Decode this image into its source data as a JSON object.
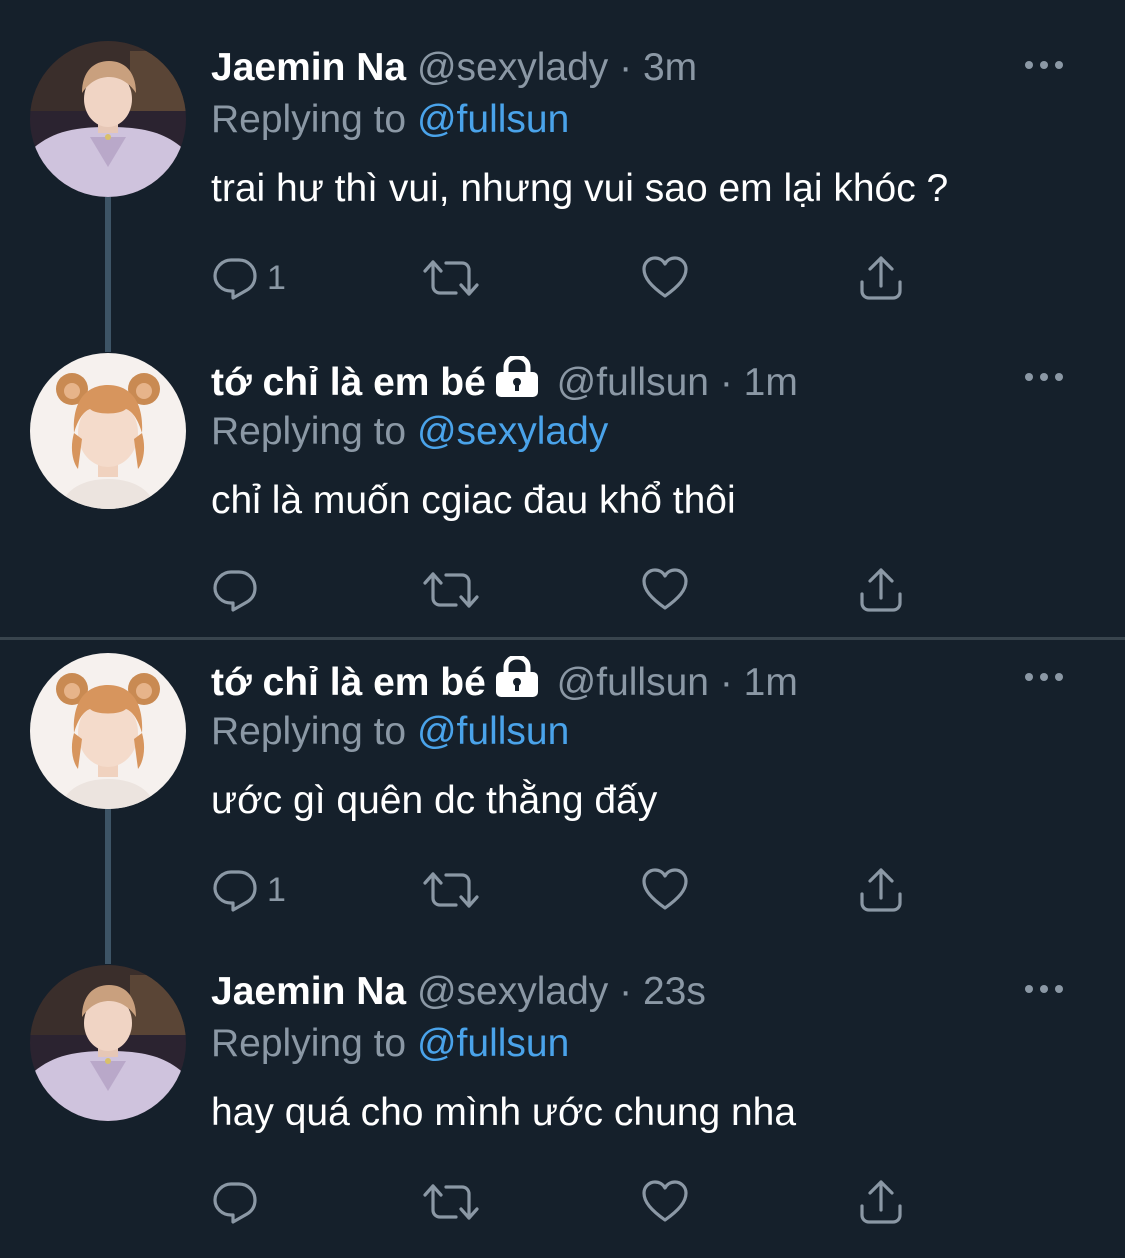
{
  "tweets": [
    {
      "name": "Jaemin Na",
      "locked": false,
      "handle": "@sexylady",
      "separator": "·",
      "time": "3m",
      "replying_prefix": "Replying to ",
      "replying_to": "@fullsun",
      "text": "trai hư thì vui, nhưng vui sao em lại khóc ?",
      "reply_count": "1",
      "avatar": "jaemin-avatar"
    },
    {
      "name": "tớ chỉ là em bé",
      "locked": true,
      "handle": "@fullsun",
      "separator": "·",
      "time": "1m",
      "replying_prefix": "Replying to ",
      "replying_to": "@sexylady",
      "text": "chỉ là muốn cgiac đau khổ thôi",
      "reply_count": "",
      "avatar": "fullsun-avatar"
    },
    {
      "name": "tớ chỉ là em bé",
      "locked": true,
      "handle": "@fullsun",
      "separator": "·",
      "time": "1m",
      "replying_prefix": "Replying to ",
      "replying_to": "@fullsun",
      "text": "ước gì quên dc thằng đấy",
      "reply_count": "1",
      "avatar": "fullsun-avatar"
    },
    {
      "name": "Jaemin Na",
      "locked": false,
      "handle": "@sexylady",
      "separator": "·",
      "time": "23s",
      "replying_prefix": "Replying to ",
      "replying_to": "@fullsun",
      "text": "hay quá cho mình ước chung nha",
      "reply_count": "",
      "avatar": "jaemin-avatar"
    }
  ],
  "colors": {
    "background": "#15202b",
    "text": "#ffffff",
    "muted": "#8b98a5",
    "mention": "#4aa3ea",
    "divider": "#38444d",
    "thread_line": "#3d5466"
  },
  "icons": {
    "reply": "reply-icon",
    "retweet": "retweet-icon",
    "like": "heart-icon",
    "share": "share-icon",
    "more": "more-icon",
    "lock": "lock-icon"
  }
}
